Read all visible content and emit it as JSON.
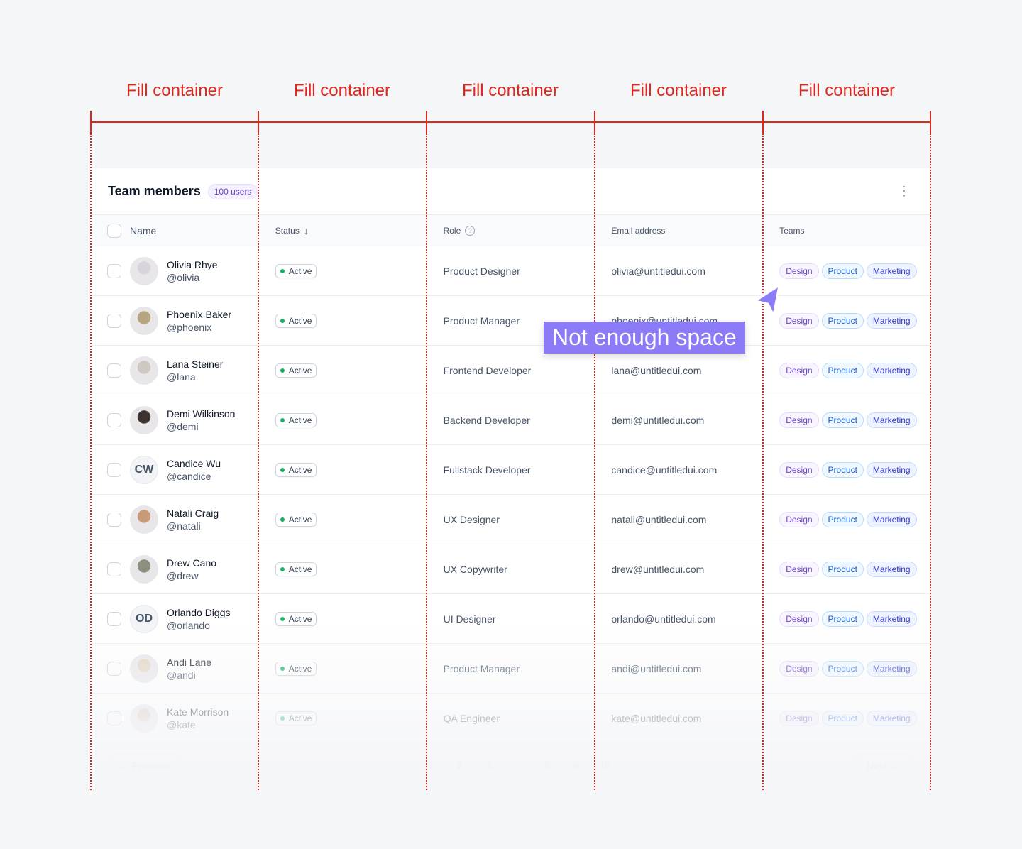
{
  "annotations": {
    "column_label": "Fill container",
    "tooltip": "Not enough space",
    "color": "#e0271e",
    "tooltip_color": "#8b7bf7"
  },
  "header": {
    "title": "Team members",
    "badge": "100 users",
    "menu_icon": "dots-vertical-icon"
  },
  "columns": {
    "name": "Name",
    "status": "Status",
    "role": "Role",
    "email": "Email address",
    "teams": "Teams"
  },
  "rows": [
    {
      "name": "Olivia Rhye",
      "handle": "@olivia",
      "status": "Active",
      "role": "Product Designer",
      "email": "olivia@untitledui.com",
      "avatar": "#d9d3dc"
    },
    {
      "name": "Phoenix Baker",
      "handle": "@phoenix",
      "status": "Active",
      "role": "Product Manager",
      "email": "phoenix@untitledui.com",
      "avatar": "#b7a57f"
    },
    {
      "name": "Lana Steiner",
      "handle": "@lana",
      "status": "Active",
      "role": "Frontend Developer",
      "email": "lana@untitledui.com",
      "avatar": "#cfc8c2"
    },
    {
      "name": "Demi Wilkinson",
      "handle": "@demi",
      "status": "Active",
      "role": "Backend Developer",
      "email": "demi@untitledui.com",
      "avatar": "#3d3330"
    },
    {
      "name": "Candice Wu",
      "handle": "@candice",
      "status": "Active",
      "role": "Fullstack Developer",
      "email": "candice@untitledui.com",
      "initials": "CW"
    },
    {
      "name": "Natali Craig",
      "handle": "@natali",
      "status": "Active",
      "role": "UX Designer",
      "email": "natali@untitledui.com",
      "avatar": "#c99a78"
    },
    {
      "name": "Drew Cano",
      "handle": "@drew",
      "status": "Active",
      "role": "UX Copywriter",
      "email": "drew@untitledui.com",
      "avatar": "#8a8f7e"
    },
    {
      "name": "Orlando Diggs",
      "handle": "@orlando",
      "status": "Active",
      "role": "UI Designer",
      "email": "orlando@untitledui.com",
      "initials": "OD"
    },
    {
      "name": "Andi Lane",
      "handle": "@andi",
      "status": "Active",
      "role": "Product Manager",
      "email": "andi@untitledui.com",
      "avatar": "#e3d4c0"
    },
    {
      "name": "Kate Morrison",
      "handle": "@kate",
      "status": "Active",
      "role": "QA Engineer",
      "email": "kate@untitledui.com",
      "avatar": "#d8ccc6"
    }
  ],
  "teams": [
    "Design",
    "Product",
    "Marketing"
  ],
  "pagination": {
    "previous": "Previous",
    "next": "Next",
    "pages": [
      "1",
      "2",
      "3",
      "...",
      "8",
      "9",
      "10"
    ]
  }
}
